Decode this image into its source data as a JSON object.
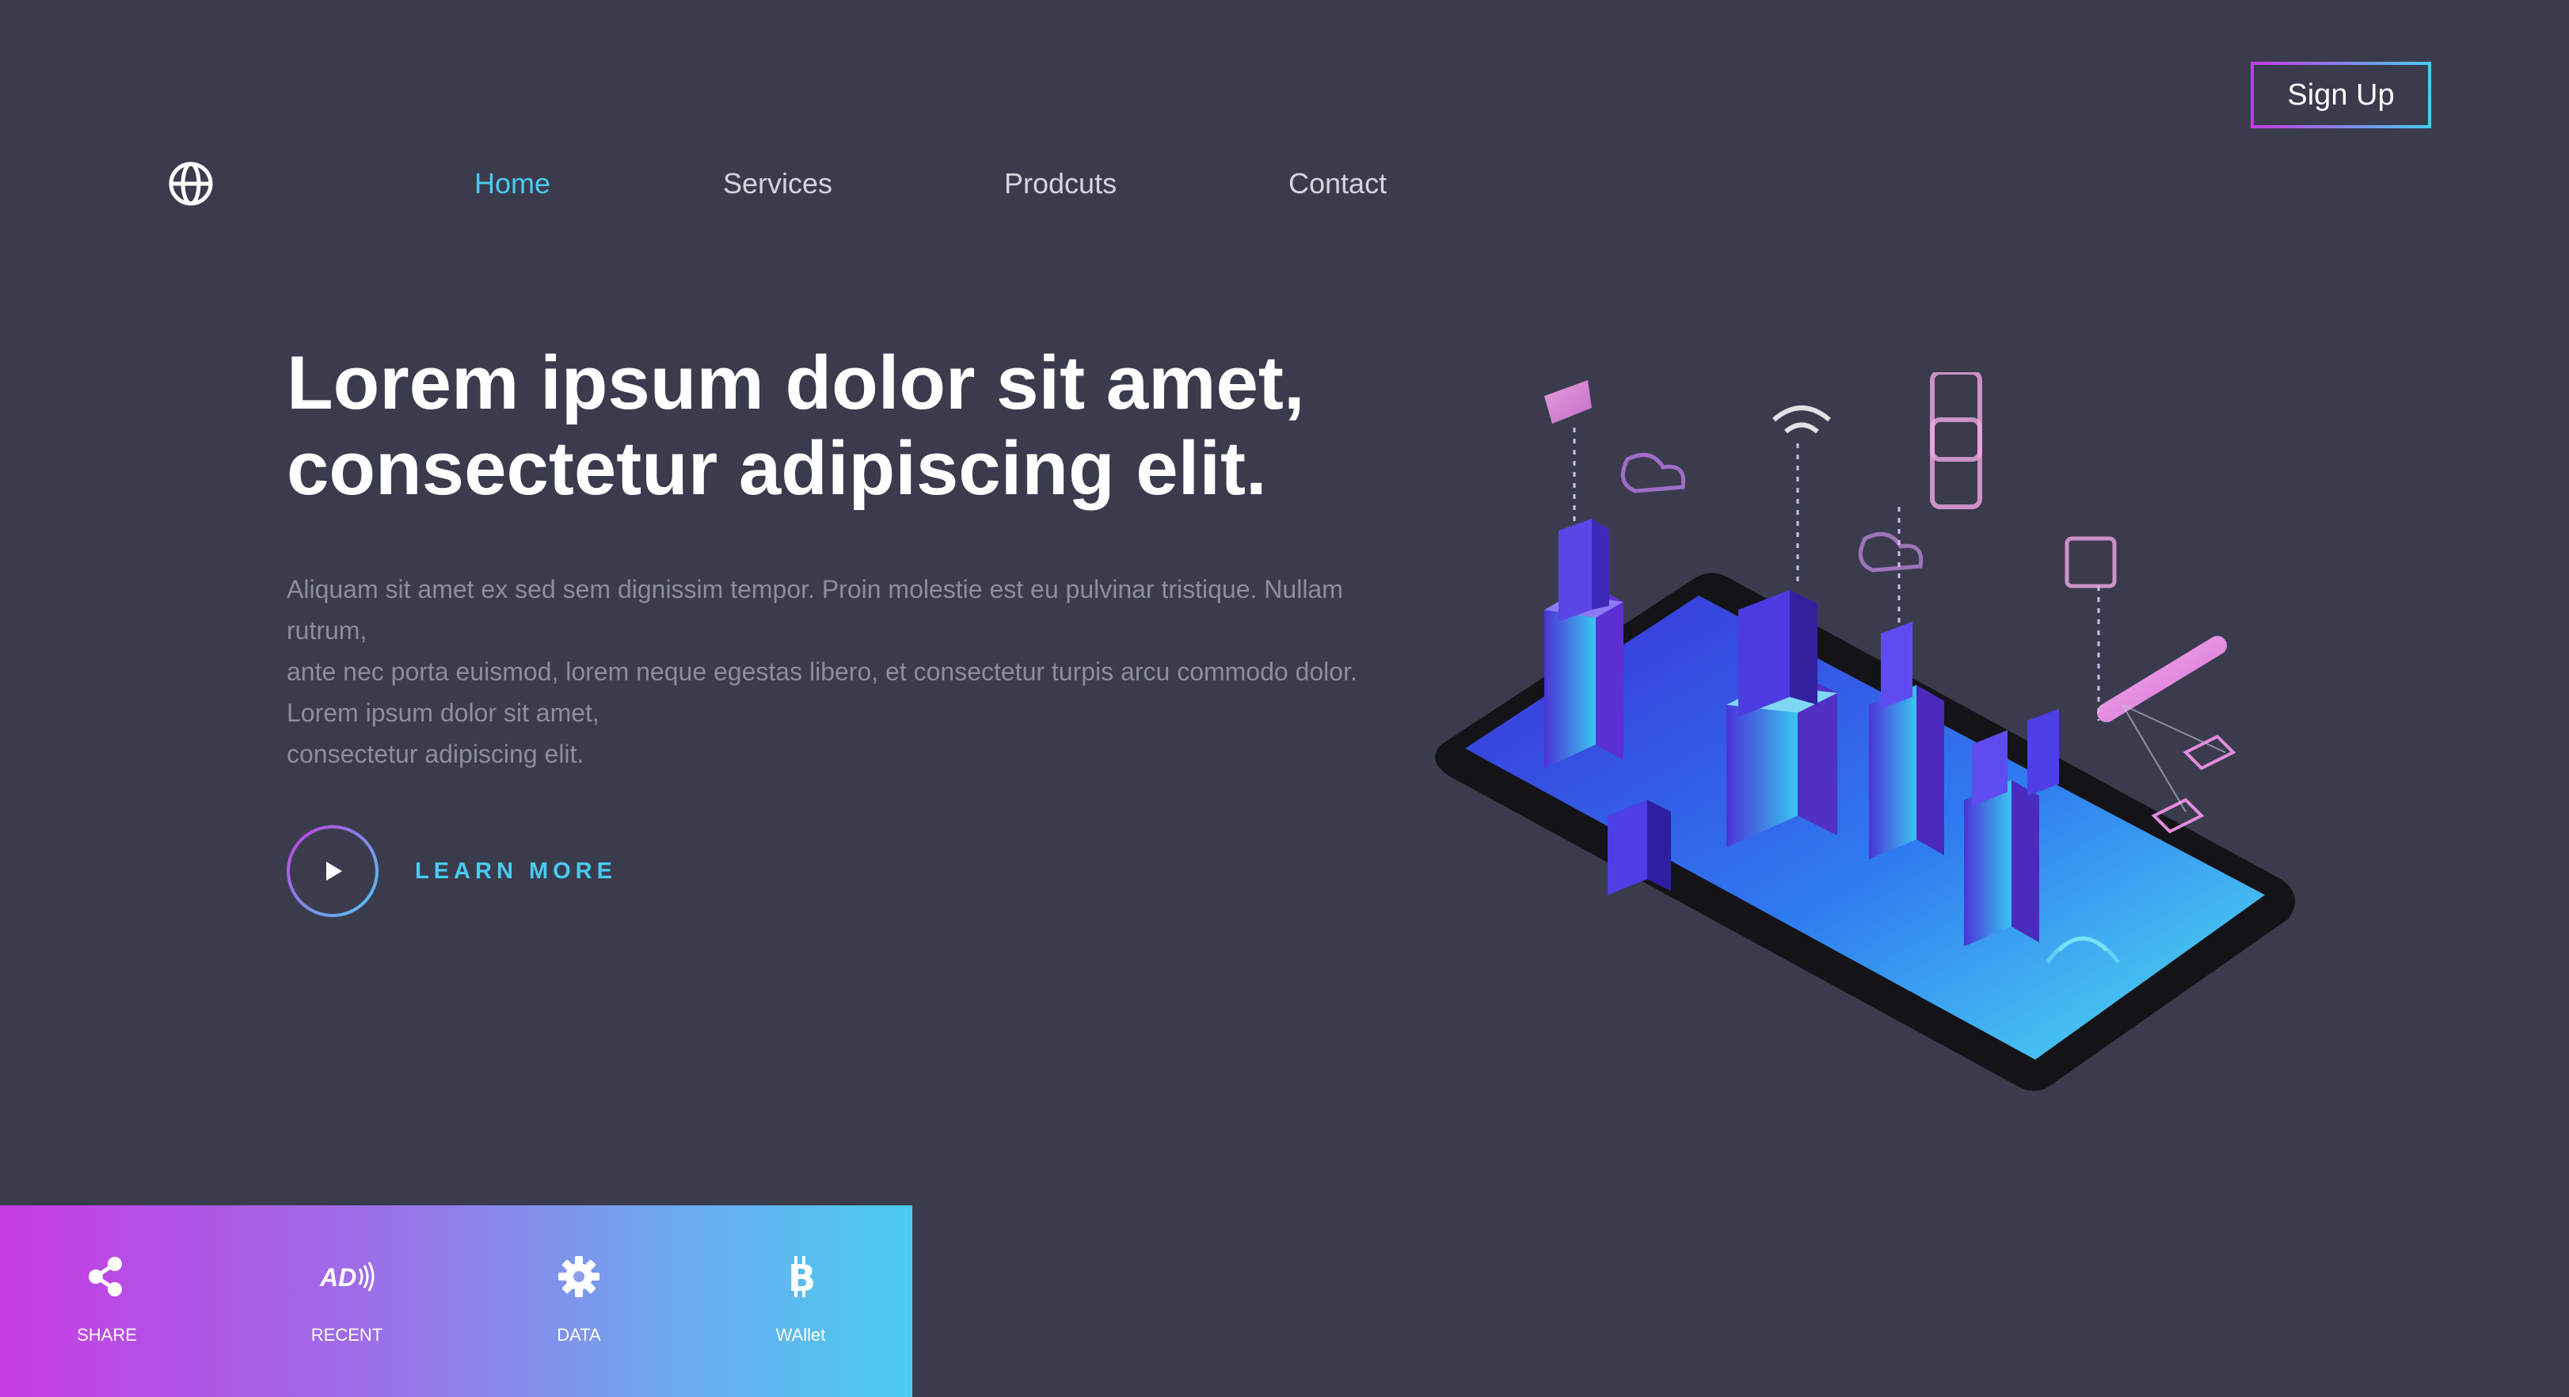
{
  "header": {
    "signup_label": "Sign Up",
    "logo_icon": "globe-icon",
    "nav": [
      {
        "label": "Home",
        "active": true
      },
      {
        "label": "Services",
        "active": false
      },
      {
        "label": "Prodcuts",
        "active": false
      },
      {
        "label": "Contact",
        "active": false
      }
    ]
  },
  "hero": {
    "title_lines": [
      "Lorem ipsum dolor sit amet,",
      "consectetur adipiscing elit."
    ],
    "body_lines": [
      "Aliquam sit amet ex sed sem dignissim tempor. Proin molestie est eu pulvinar tristique. Nullam",
      "rutrum,",
      "ante nec porta euismod, lorem neque egestas libero, et consectetur turpis arcu commodo dolor.",
      "Lorem ipsum dolor sit amet,",
      "consectetur adipiscing elit."
    ],
    "play_icon": "play-icon",
    "learn_more_label": "LEARN MORE"
  },
  "illustration": {
    "icon": "isometric-smart-city-phone-illustration"
  },
  "bottom_bar": {
    "items": [
      {
        "label": "SHARE",
        "icon": "share-icon"
      },
      {
        "label": "RECENT",
        "icon": "ad-icon"
      },
      {
        "label": "DATA",
        "icon": "gear-icon"
      },
      {
        "label": "WAllet",
        "icon": "bitcoin-icon"
      }
    ]
  },
  "colors": {
    "background": "#3a3c4e",
    "accent_cyan": "#49cbf0",
    "accent_magenta": "#c63be0",
    "body_text": "#8c8e9c"
  }
}
